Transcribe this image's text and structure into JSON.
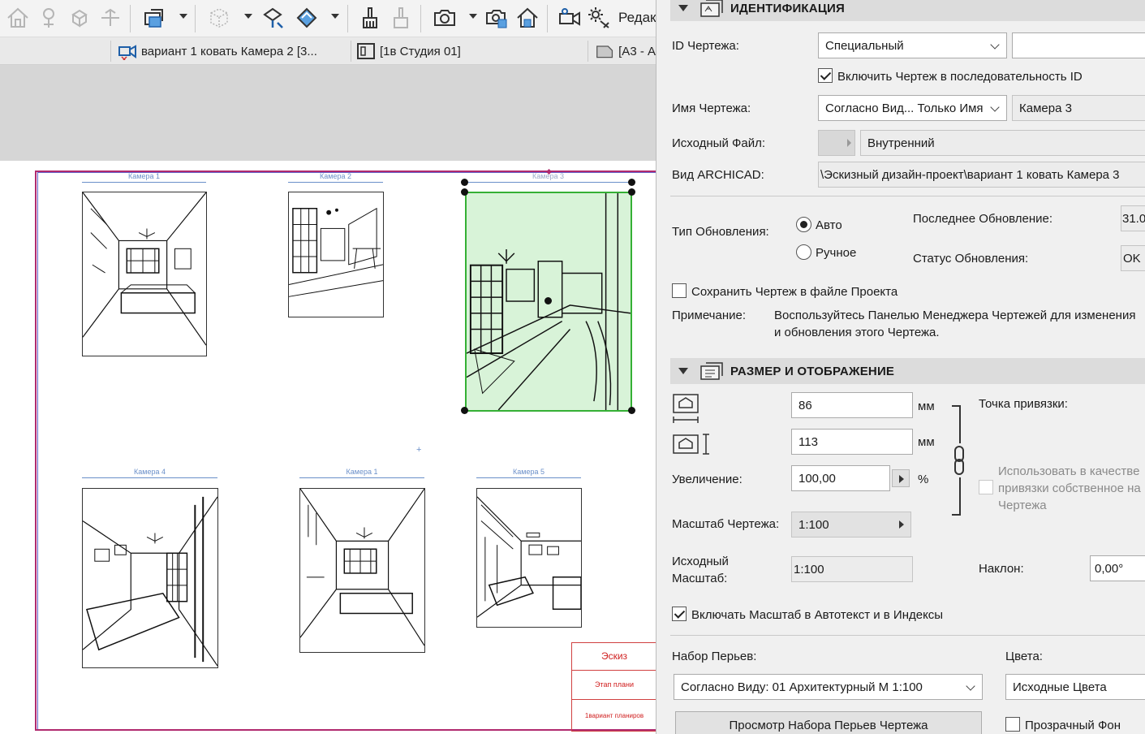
{
  "toolbar": {
    "edit_label": "Редак",
    "icons": [
      "home-icon",
      "camera-pin-icon",
      "rotate-cube-icon",
      "align-icon",
      "layer-stack-icon",
      "cube-icon",
      "cube-edit-icon",
      "fill-icon",
      "brush-icon",
      "gradient-brush-icon",
      "camera-icon",
      "multi-camera-icon",
      "building-icon",
      "video-camera-icon",
      "settings-sun-icon"
    ]
  },
  "tabs": [
    {
      "label": "вариант 1 ковать Камера 2 [3...",
      "icon": "camera-tab-icon"
    },
    {
      "label": "[1в Студия 01]",
      "icon": "layout-tab-icon"
    },
    {
      "label": "[А3 - А",
      "icon": "sheet-tab-icon"
    }
  ],
  "canvas": {
    "drawings": [
      {
        "label": "Камера 1"
      },
      {
        "label": "Камера 2"
      },
      {
        "label": "Камера 3",
        "selected": true
      },
      {
        "label": "Камера 4"
      },
      {
        "label": "Камера 1"
      },
      {
        "label": "Камера 5"
      }
    ],
    "title_block": [
      "Эскиз",
      "Этап плани",
      "1вариант планиров"
    ]
  },
  "identification": {
    "title": "ИДЕНТИФИКАЦИЯ",
    "drawing_id_label": "ID Чертежа:",
    "drawing_id_value": "Специальный",
    "drawing_id_custom": "",
    "include_in_sequence_label": "Включить Чертеж в последовательность ID",
    "include_in_sequence": true,
    "drawing_name_label": "Имя Чертежа:",
    "drawing_name_value": "Согласно Вид... Только Имя",
    "drawing_name_custom": "Камера 3",
    "source_file_label": "Исходный Файл:",
    "source_file_value": "Внутренний",
    "archicad_view_label": "Вид ARCHICAD:",
    "archicad_view_value": "\\Эскизный дизайн-проект\\вариант 1 ковать Камера 3",
    "update_type_label": "Тип Обновления:",
    "update_auto": "Авто",
    "update_manual": "Ручное",
    "update_selected": "auto",
    "last_update_label": "Последнее Обновление:",
    "last_update_value": "31.0",
    "update_status_label": "Статус Обновления:",
    "update_status_value": "OK",
    "save_in_project_label": "Сохранить Чертеж в файле Проекта",
    "save_in_project": false,
    "note_label": "Примечание:",
    "note_line1": "Воспользуйтесь Панелью Менеджера Чертежей для изменения",
    "note_line2": "и обновления этого Чертежа."
  },
  "size_display": {
    "title": "РАЗМЕР И ОТОБРАЖЕНИЕ",
    "width_value": "86",
    "height_value": "113",
    "unit_mm": "мм",
    "magnification_label": "Увеличение:",
    "magnification_value": "100,00",
    "percent": "%",
    "anchor_label": "Точка привязки:",
    "use_own_anchor_line1": "Использовать в качестве",
    "use_own_anchor_line2": "привязки собственное на",
    "use_own_anchor_line3": "Чертежа",
    "drawing_scale_label": "Масштаб Чертежа:",
    "drawing_scale_value": "1:100",
    "original_scale_label_1": "Исходный",
    "original_scale_label_2": "Масштаб:",
    "original_scale_value": "1:100",
    "rotation_label": "Наклон:",
    "rotation_value": "0,00°",
    "include_scale_label": "Включать Масштаб в Автотекст и в Индексы",
    "include_scale": true,
    "pen_set_label": "Набор Перьев:",
    "pen_set_value": "Согласно Виду: 01 Архитектурный М 1:100",
    "colors_label": "Цвета:",
    "colors_value": "Исходные Цвета",
    "preview_pen_button": "Просмотр Набора Перьев Чертежа",
    "transparent_bg_label": "Прозрачный Фон",
    "transparent_bg": false
  }
}
